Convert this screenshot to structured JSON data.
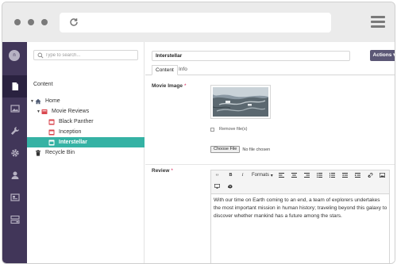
{
  "browser": {
    "icons": [
      "reload-icon",
      "hamburger-menu-icon"
    ]
  },
  "user": {
    "initials": "n"
  },
  "sidebar": {
    "items": [
      {
        "icon": "document-icon",
        "active": true
      },
      {
        "icon": "image-icon",
        "active": false
      },
      {
        "icon": "wrench-icon",
        "active": false
      },
      {
        "icon": "gear-icon",
        "active": false
      },
      {
        "icon": "user-icon",
        "active": false
      },
      {
        "icon": "address-card-icon",
        "active": false
      },
      {
        "icon": "list-form-icon",
        "active": false
      }
    ]
  },
  "tree": {
    "search_placeholder": "Type to search...",
    "section_title": "Content",
    "nodes": [
      {
        "label": "Home",
        "icon": "home-icon",
        "expanded": true
      },
      {
        "label": "Movie Reviews",
        "icon": "folder-icon",
        "expanded": true
      },
      {
        "label": "Black Panther",
        "icon": "page-icon"
      },
      {
        "label": "Inception",
        "icon": "page-icon"
      },
      {
        "label": "Interstellar",
        "icon": "page-icon",
        "selected": true
      },
      {
        "label": "Recycle Bin",
        "icon": "trash-icon"
      }
    ]
  },
  "editor": {
    "name_value": "Interstellar",
    "actions_label": "Actions",
    "tabs": [
      {
        "label": "Content",
        "active": true
      },
      {
        "label": "Info",
        "active": false
      }
    ],
    "movie_image": {
      "label": "Movie Image",
      "required_mark": "*",
      "remove_label": "Remove file(s)",
      "choose_label": "Choose File",
      "no_file_label": "No file chosen"
    },
    "review": {
      "label": "Review",
      "required_mark": "*",
      "formats_label": "Formats",
      "body": "With our time on Earth coming to an end, a team of explorers undertakes the most important mission in human history; traveling beyond this galaxy to discover whether mankind has a future among the stars."
    }
  },
  "colors": {
    "nav_bg": "#413659",
    "selected_bg": "#35b2a4",
    "actions_bg": "#5b5775",
    "required": "#d42054"
  }
}
